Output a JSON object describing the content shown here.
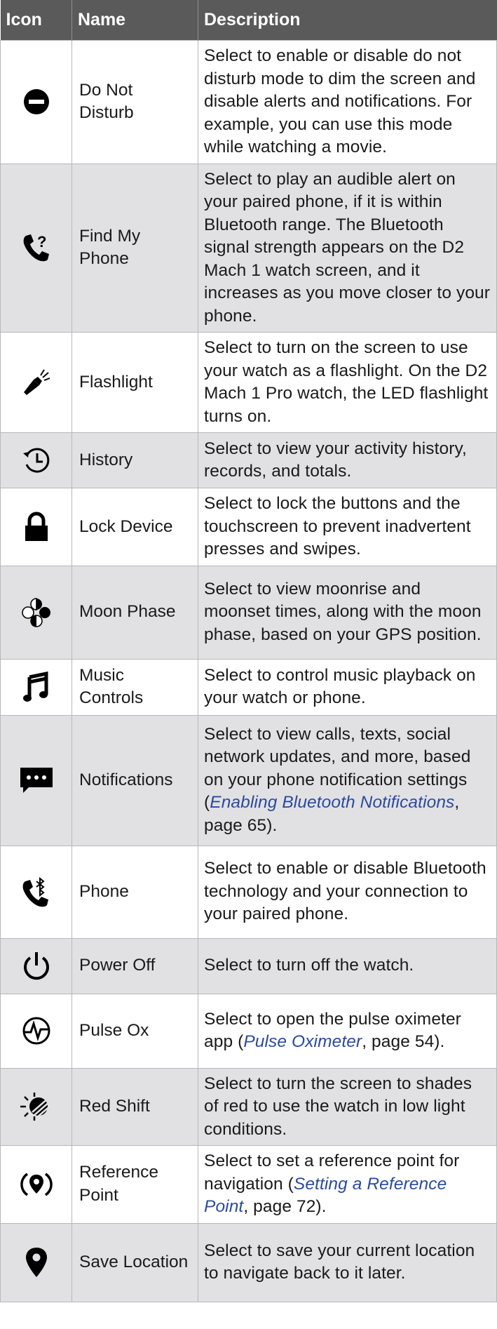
{
  "headers": {
    "icon": "Icon",
    "name": "Name",
    "description": "Description"
  },
  "rows": [
    {
      "icon": "do-not-disturb-icon",
      "name": "Do Not Disturb",
      "description": "Select to enable or disable do not disturb mode to dim the screen and disable alerts and notifica­tions. For example, you can use this mode while watching a movie."
    },
    {
      "icon": "find-my-phone-icon",
      "name": "Find My Phone",
      "description": "Select to play an audible alert on your paired phone, if it is within Bluetooth range. The Bluetooth signal strength appears on the D2 Mach 1 watch screen, and it increases as you move closer to your phone."
    },
    {
      "icon": "flashlight-icon",
      "name": "Flashlight",
      "description": "Select to turn on the screen to use your watch as a flashlight. On the D2 Mach 1 Pro watch, the LED flashlight turns on."
    },
    {
      "icon": "history-icon",
      "name": "History",
      "description": "Select to view your activity history, records, and totals."
    },
    {
      "icon": "lock-icon",
      "name": "Lock Device",
      "description": "Select to lock the buttons and the touchscreen to prevent inad­vertent presses and swipes."
    },
    {
      "icon": "moon-phase-icon",
      "name": "Moon Phase",
      "description": "Select to view moonrise and moonset times, along with the moon phase, based on your GPS position."
    },
    {
      "icon": "music-note-icon",
      "name": "Music Controls",
      "description": "Select to control music playback on your watch or phone."
    },
    {
      "icon": "notifications-icon",
      "name": "Notifications",
      "description": "Select to view calls, texts, social network updates, and more, based on your phone notification settings (",
      "link": "Enabling Bluetooth Notifi­cations",
      "suffix": ", page 65)."
    },
    {
      "icon": "phone-bluetooth-icon",
      "name": "Phone",
      "description": "Select to enable or disable Bluetooth technology and your connection to your paired phone."
    },
    {
      "icon": "power-icon",
      "name": "Power Off",
      "description": "Select to turn off the watch."
    },
    {
      "icon": "pulse-ox-icon",
      "name": "Pulse Ox",
      "description": "Select to open the pulse oximeter app (",
      "link": "Pulse Oximeter",
      "suffix": ", page 54)."
    },
    {
      "icon": "red-shift-icon",
      "name": "Red Shift",
      "description": "Select to turn the screen to shades of red to use the watch in low light conditions."
    },
    {
      "icon": "reference-point-icon",
      "name": "Reference Point",
      "description": "Select to set a reference point for navigation (",
      "link": "Setting a Reference Point",
      "suffix": ", page 72)."
    },
    {
      "icon": "location-pin-icon",
      "name": "Save Location",
      "description": "Select to save your current location to navigate back to it later."
    }
  ]
}
